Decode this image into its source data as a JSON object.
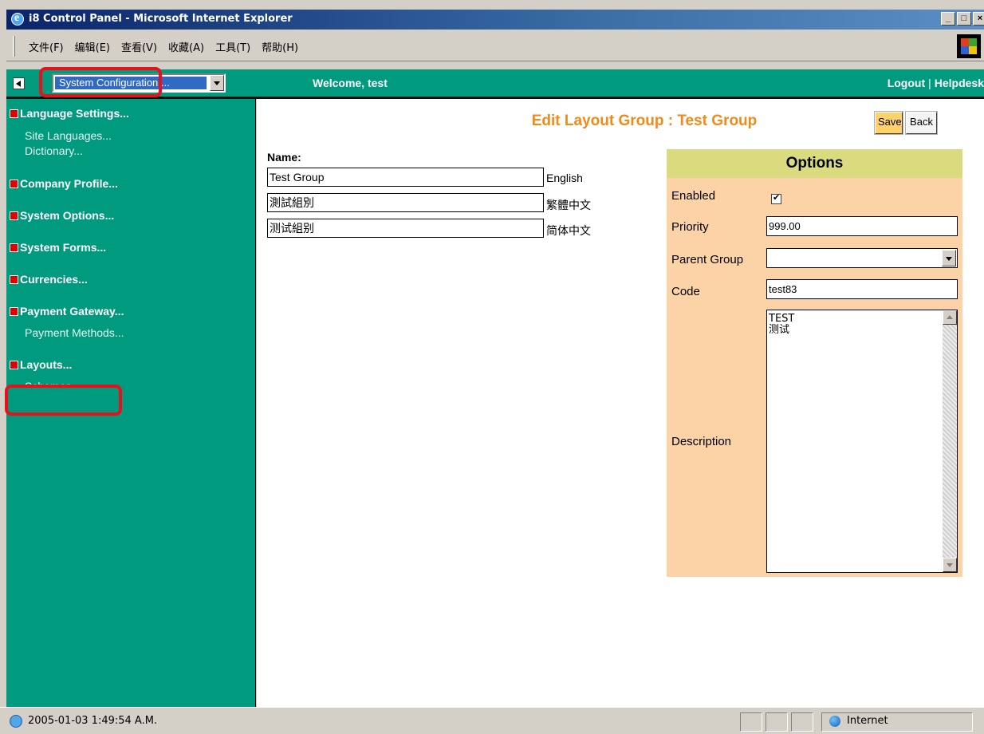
{
  "window": {
    "title": "i8 Control Panel - Microsoft Internet Explorer"
  },
  "menu": [
    "文件(F)",
    "编辑(E)",
    "查看(V)",
    "收藏(A)",
    "工具(T)",
    "帮助(H)"
  ],
  "header": {
    "module_select": "System Configuration ...",
    "welcome": "Welcome, test",
    "logout": "Logout",
    "separator": "|",
    "helpdesk": "Helpdesk"
  },
  "sidebar": {
    "sections": [
      {
        "label": "Language Settings...",
        "items": [
          "Site Languages...",
          "Dictionary..."
        ]
      },
      {
        "label": "Company Profile...",
        "items": []
      },
      {
        "label": "System Options...",
        "items": []
      },
      {
        "label": "System Forms...",
        "items": []
      },
      {
        "label": "Currencies...",
        "items": []
      },
      {
        "label": "Payment Gateway...",
        "items": [
          "Payment Methods..."
        ]
      },
      {
        "label": "Layouts...",
        "items": [
          "Schemes..."
        ]
      }
    ]
  },
  "page": {
    "title": "Edit Layout Group : Test Group",
    "save_label": "Save",
    "back_label": "Back",
    "name_label": "Name:",
    "names": [
      {
        "value": "Test Group",
        "language": "English"
      },
      {
        "value": "測試組別",
        "language": "繁體中文"
      },
      {
        "value": "测试組别",
        "language": "简体中文"
      }
    ]
  },
  "options": {
    "heading": "Options",
    "enabled_label": "Enabled",
    "enabled_checked": true,
    "priority_label": "Priority",
    "priority_value": "999.00",
    "parent_label": "Parent Group",
    "parent_value": "",
    "code_label": "Code",
    "code_value": "test83",
    "description_label": "Description",
    "description_value": "TEST\n测试"
  },
  "statusbar": {
    "text": "2005-01-03 1:49:54 A.M.",
    "zone": "Internet"
  },
  "colors": {
    "accent_green": "#009a7e",
    "title_orange": "#f08a18",
    "options_bg": "#fcd3a6",
    "options_header": "#dada7e",
    "highlight_red": "#e8101a"
  }
}
